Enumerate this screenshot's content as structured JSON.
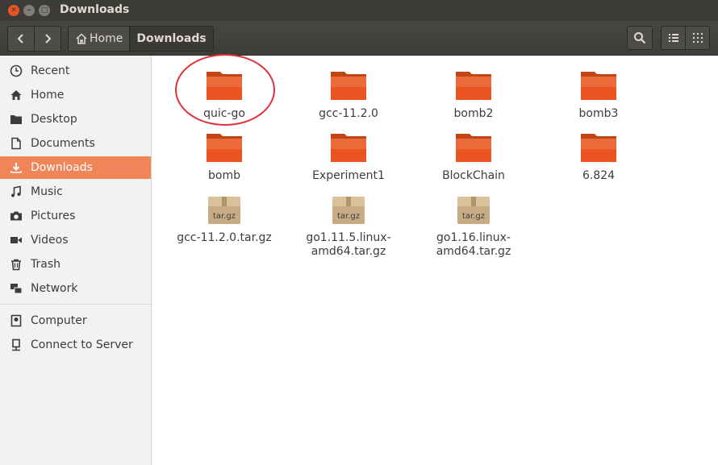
{
  "window": {
    "title": "Downloads"
  },
  "toolbar": {
    "breadcrumbs": [
      "Home",
      "Downloads"
    ]
  },
  "sidebar": {
    "places": [
      {
        "label": "Recent",
        "icon": "clock-icon"
      },
      {
        "label": "Home",
        "icon": "home-icon"
      },
      {
        "label": "Desktop",
        "icon": "folder-icon"
      },
      {
        "label": "Documents",
        "icon": "document-icon"
      },
      {
        "label": "Downloads",
        "icon": "download-icon",
        "active": true
      },
      {
        "label": "Music",
        "icon": "music-icon"
      },
      {
        "label": "Pictures",
        "icon": "camera-icon"
      },
      {
        "label": "Videos",
        "icon": "video-icon"
      },
      {
        "label": "Trash",
        "icon": "trash-icon"
      },
      {
        "label": "Network",
        "icon": "network-icon"
      }
    ],
    "devices": [
      {
        "label": "Computer",
        "icon": "computer-icon"
      },
      {
        "label": "Connect to Server",
        "icon": "server-icon"
      }
    ]
  },
  "files": [
    {
      "name": "quic-go",
      "type": "folder"
    },
    {
      "name": "gcc-11.2.0",
      "type": "folder"
    },
    {
      "name": "bomb2",
      "type": "folder"
    },
    {
      "name": "bomb3",
      "type": "folder"
    },
    {
      "name": "bomb",
      "type": "folder"
    },
    {
      "name": "Experiment1",
      "type": "folder"
    },
    {
      "name": "BlockChain",
      "type": "folder"
    },
    {
      "name": "6.824",
      "type": "folder"
    },
    {
      "name": "gcc-11.2.0.tar.gz",
      "type": "archive",
      "badge": "tar.gz"
    },
    {
      "name": "go1.11.5.linux-amd64.tar.gz",
      "line1": "go1.11.5.linux-",
      "line2": "amd64.tar.gz",
      "type": "archive",
      "badge": "tar.gz"
    },
    {
      "name": "go1.16.linux-amd64.tar.gz",
      "line1": "go1.16.linux-",
      "line2": "amd64.tar.gz",
      "type": "archive",
      "badge": "tar.gz"
    }
  ],
  "colors": {
    "accent": "#f0855a",
    "folder": "#e95420",
    "highlight": "#e0303a",
    "titlebar": "#3c3b37"
  }
}
